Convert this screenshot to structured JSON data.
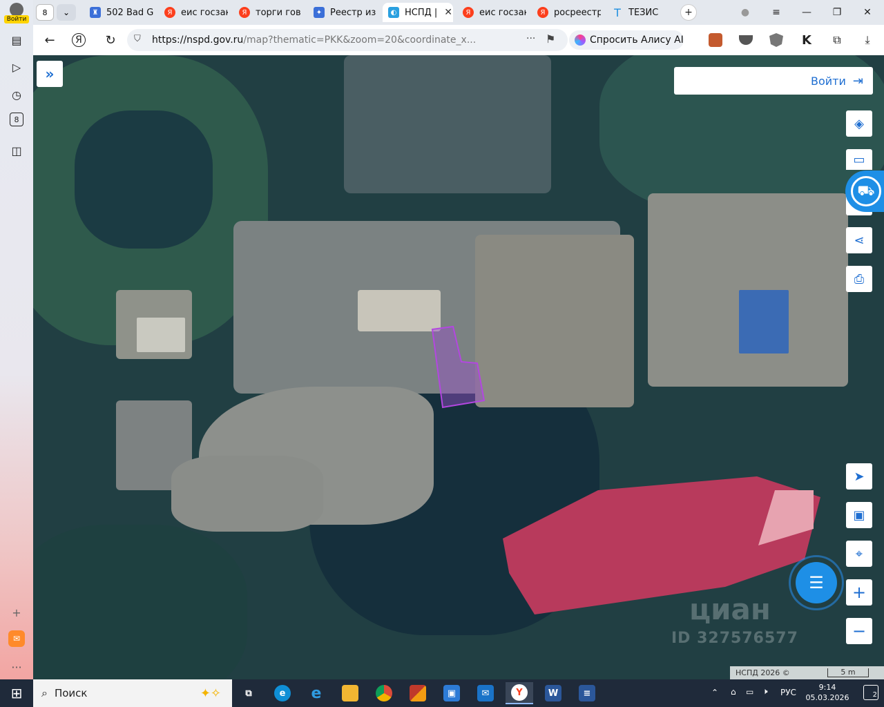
{
  "sidebar": {
    "profile_label": "Войти",
    "items": [
      {
        "icon": "collections-icon",
        "glyph": "▤"
      },
      {
        "icon": "play-icon",
        "glyph": "▷"
      },
      {
        "icon": "history-icon",
        "glyph": "◷"
      },
      {
        "icon": "counter-icon",
        "glyph": "8"
      },
      {
        "icon": "screenshot-icon",
        "glyph": "◫"
      }
    ],
    "add_glyph": "+",
    "more_glyph": "···"
  },
  "tabs": {
    "counter": "8",
    "items": [
      {
        "label": "502 Bad G",
        "fav": "blue",
        "glyph": "♜"
      },
      {
        "label": "еис госзак",
        "fav": "ya",
        "glyph": "Я"
      },
      {
        "label": "торги гов",
        "fav": "ya",
        "glyph": "Я"
      },
      {
        "label": "Реестр из",
        "fav": "blue",
        "glyph": "✦"
      },
      {
        "label": "НСПД |",
        "fav": "nspd",
        "glyph": "◐",
        "active": true
      },
      {
        "label": "еис госзак",
        "fav": "ya",
        "glyph": "Я"
      },
      {
        "label": "росреестр",
        "fav": "ya",
        "glyph": "Я"
      },
      {
        "label": "ТЕЗИС",
        "fav": "tez",
        "glyph": "T"
      }
    ],
    "new_tab_glyph": "+",
    "close_glyph": "✕"
  },
  "navbar": {
    "url_host": "https://nspd.gov.ru",
    "url_path": "/map?thematic=PKK&zoom=20&coordinate_x...",
    "alice_label": "Спросить Алису AI"
  },
  "map": {
    "login_label": "Войти",
    "attribution": "НСПД 2026 ©",
    "scale_label": "5 m",
    "watermark_name": "циан",
    "watermark_id": "ID 327576577"
  },
  "taskbar": {
    "search_label": "Поиск",
    "apps": [
      {
        "name": "task-view",
        "glyph": "⧉",
        "color": "#1f2a3a"
      },
      {
        "name": "edge-new",
        "glyph": "e",
        "color": "#0f8fd6"
      },
      {
        "name": "internet-explorer",
        "glyph": "e",
        "color": "#1e90ff"
      },
      {
        "name": "file-explorer",
        "glyph": "▬",
        "color": "#f2b632"
      },
      {
        "name": "chrome",
        "glyph": "●",
        "color": "#dd4b39"
      },
      {
        "name": "app-grid",
        "glyph": "▦",
        "color": "#c0392b"
      },
      {
        "name": "store",
        "glyph": "▣",
        "color": "#2d7bd6"
      },
      {
        "name": "outlook",
        "glyph": "✉",
        "color": "#1a73c8"
      },
      {
        "name": "yandex-browser",
        "glyph": "Y",
        "color": "#ffffff"
      },
      {
        "name": "word",
        "glyph": "W",
        "color": "#2b579a"
      },
      {
        "name": "document",
        "glyph": "≡",
        "color": "#2b579a"
      }
    ],
    "lang": "РУС",
    "time": "9:14",
    "date": "05.03.2026",
    "notif_count": "2"
  }
}
